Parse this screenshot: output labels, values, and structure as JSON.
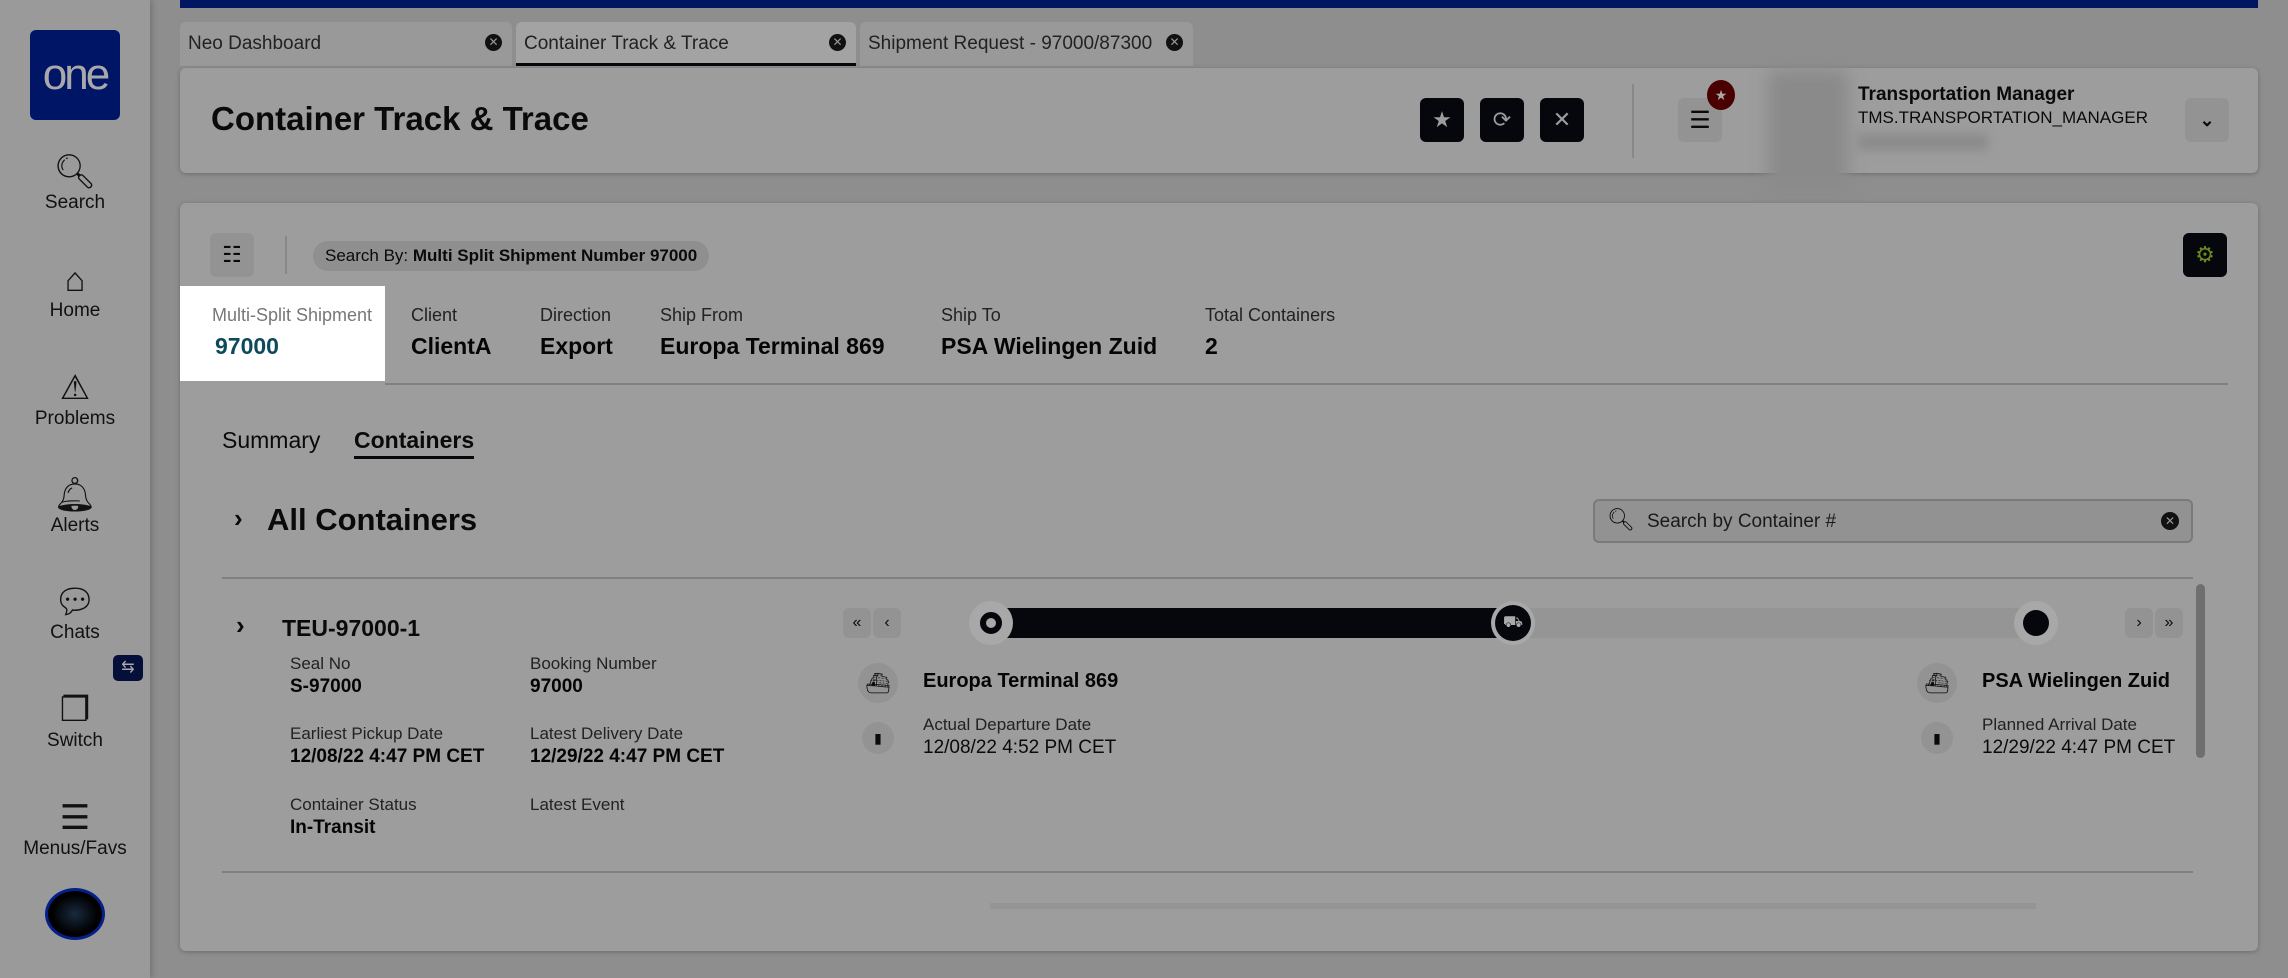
{
  "sidebar": {
    "logo": "one",
    "items": [
      {
        "label": "Search",
        "icon": "search-icon"
      },
      {
        "label": "Home",
        "icon": "home-icon"
      },
      {
        "label": "Problems",
        "icon": "warning-icon"
      },
      {
        "label": "Alerts",
        "icon": "bell-icon"
      },
      {
        "label": "Chats",
        "icon": "chat-icon"
      },
      {
        "label": "Switch",
        "icon": "windows-icon"
      },
      {
        "label": "Menus/Favs",
        "icon": "menu-icon"
      }
    ]
  },
  "tabs": [
    {
      "label": "Neo Dashboard"
    },
    {
      "label": "Container Track & Trace",
      "active": true
    },
    {
      "label": "Shipment Request - 97000/87300"
    }
  ],
  "header": {
    "title": "Container Track & Trace",
    "user_name": "Transportation Manager",
    "user_role": "TMS.TRANSPORTATION_MANAGER"
  },
  "search_chip": {
    "prefix": "Search By:",
    "value": "Multi Split Shipment Number 97000"
  },
  "summary": [
    {
      "label": "Multi-Split Shipment",
      "value": "97000"
    },
    {
      "label": "Client",
      "value": "ClientA"
    },
    {
      "label": "Direction",
      "value": "Export"
    },
    {
      "label": "Ship From",
      "value": "Europa Terminal 869"
    },
    {
      "label": "Ship To",
      "value": "PSA Wielingen Zuid"
    },
    {
      "label": "Total Containers",
      "value": "2"
    }
  ],
  "subtabs": [
    "Summary",
    "Containers"
  ],
  "containers_section": {
    "title": "All Containers",
    "search_placeholder": "Search by Container #"
  },
  "container": {
    "id": "TEU-97000-1",
    "fields": [
      {
        "label": "Seal No",
        "value": "S-97000"
      },
      {
        "label": "Booking Number",
        "value": "97000"
      },
      {
        "label": "Earliest Pickup Date",
        "value": "12/08/22 4:47 PM CET"
      },
      {
        "label": "Latest Delivery Date",
        "value": "12/29/22 4:47 PM CET"
      },
      {
        "label": "Container Status",
        "value": "In-Transit"
      },
      {
        "label": "Latest Event",
        "value": ""
      }
    ],
    "progress_pct": 50,
    "origin": {
      "name": "Europa Terminal 869",
      "date_label": "Actual Departure Date",
      "date": "12/08/22 4:52 PM CET"
    },
    "destination": {
      "name": "PSA Wielingen Zuid",
      "date_label": "Planned Arrival Date",
      "date": "12/29/22 4:47 PM CET"
    }
  },
  "colors": {
    "brand": "#001566",
    "highlight": "#ffffff",
    "value_accent": "#0d4a5c"
  }
}
